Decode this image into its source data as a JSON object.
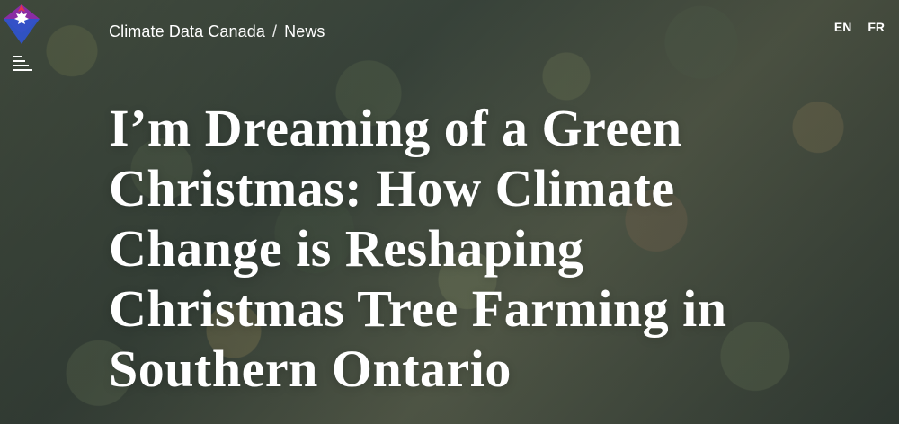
{
  "breadcrumb": {
    "site": "Climate Data Canada",
    "separator": "/",
    "section": "News"
  },
  "languages": [
    "EN",
    "FR"
  ],
  "title": "I’m Dreaming of a Green Christmas: How Climate Change is Reshaping Christmas Tree Farming in Southern Ontario",
  "icons": {
    "logo": "climate-data-canada-logo",
    "menu": "menu-icon"
  },
  "colors": {
    "logo_red": "#e3324f",
    "logo_purple": "#8a2ca4",
    "logo_blue": "#2f53c9",
    "text": "#ffffff"
  }
}
